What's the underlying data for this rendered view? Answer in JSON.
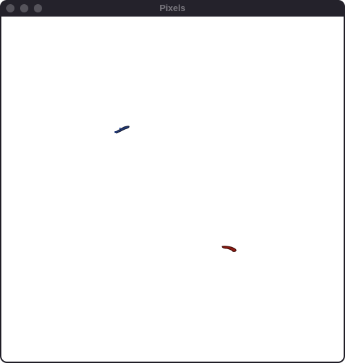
{
  "window": {
    "title": "Pixels",
    "controls": {
      "close": "close-button",
      "minimize": "minimize-button",
      "zoom": "zoom-button"
    }
  },
  "colors": {
    "titlebar": "#24222b",
    "title_text": "#77757c",
    "control": "#55535b",
    "canvas": "#ffffff",
    "blue_stroke": "#233a78",
    "red_stroke": "#8a1a12"
  },
  "canvas": {
    "strokes": [
      {
        "name": "blue-pixel-stroke",
        "color": "blue"
      },
      {
        "name": "red-pixel-stroke",
        "color": "red"
      }
    ]
  }
}
